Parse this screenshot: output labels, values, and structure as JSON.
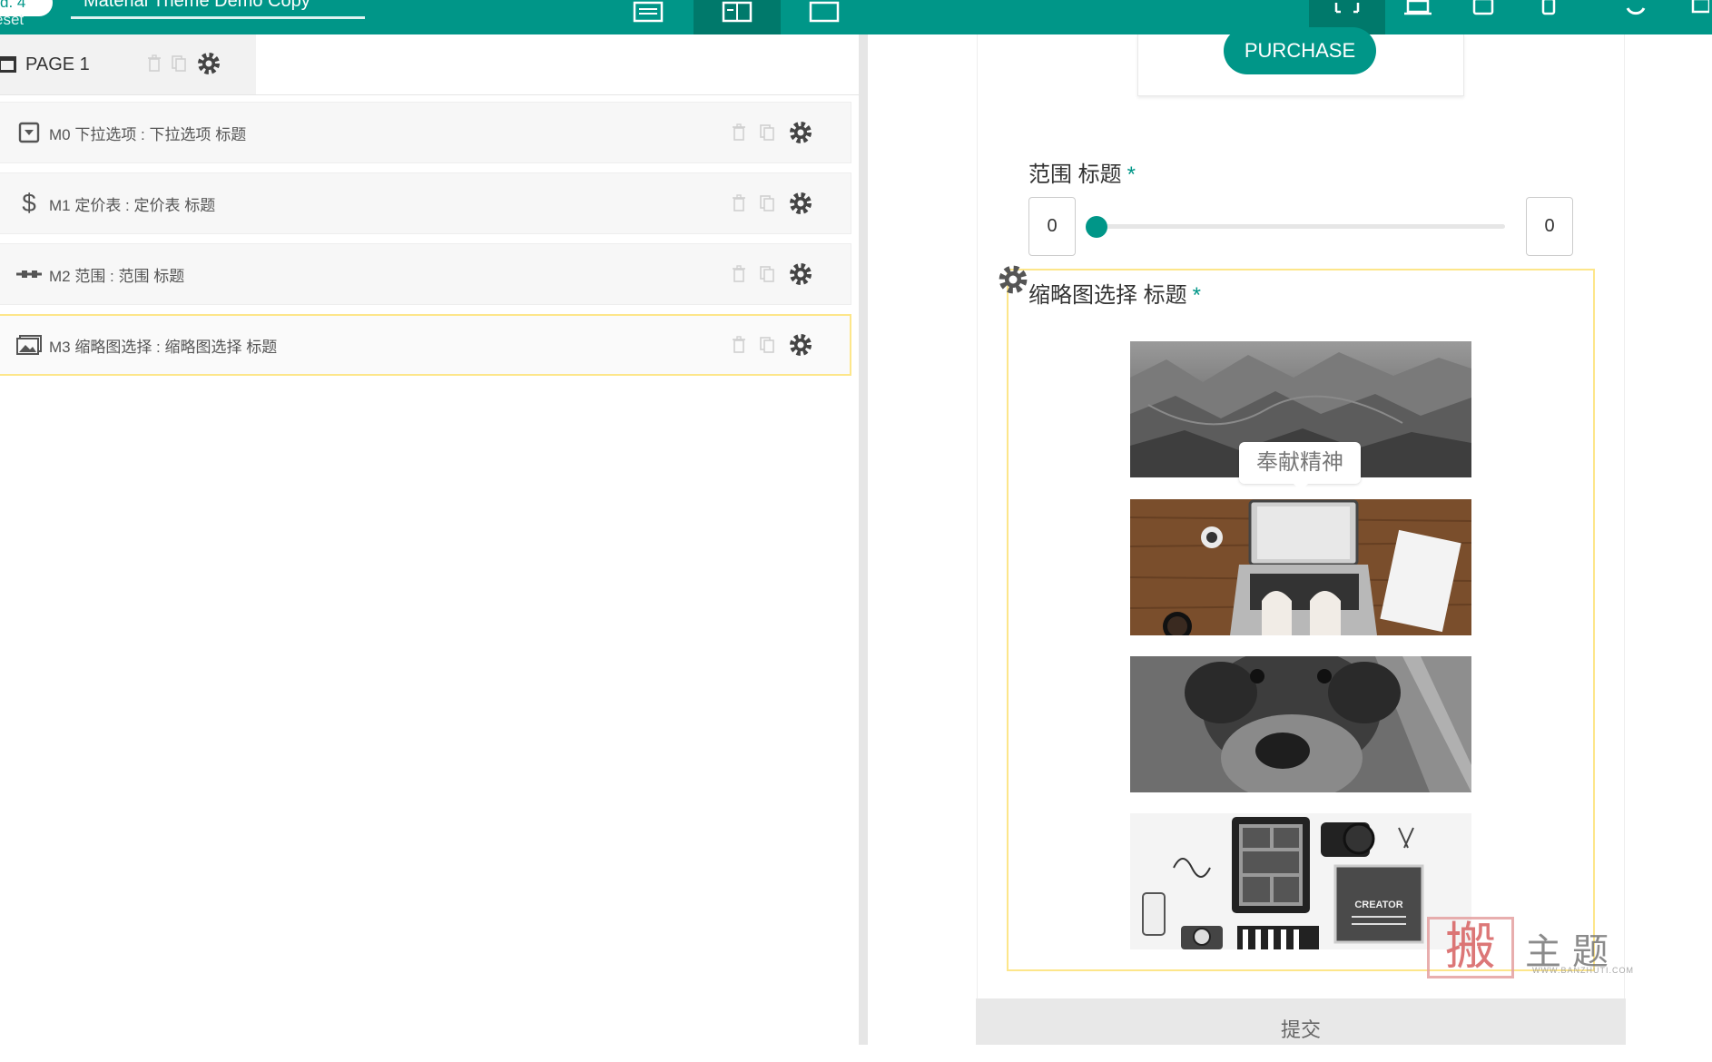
{
  "toolbar": {
    "pill_label": "d. 4",
    "reset_label": "eset",
    "form_title": "Material Theme Demo Copy",
    "buttons": [
      "list-view-icon",
      "split-view-icon",
      "preview-icon"
    ],
    "device_buttons": [
      "fullscreen-icon",
      "desktop-icon",
      "tablet-icon",
      "mobile-icon",
      "refresh-icon"
    ]
  },
  "left": {
    "page_label": "PAGE 1",
    "rows": [
      {
        "label": "M0 下拉选项 : 下拉选项 标题",
        "icon": "dropdown-icon"
      },
      {
        "label": "M1 定价表 : 定价表 标题",
        "icon": "dollar-icon"
      },
      {
        "label": "M2 范围 : 范围 标题",
        "icon": "range-icon"
      },
      {
        "label": "M3 缩略图选择 : 缩略图选择 标题",
        "icon": "image-icon"
      }
    ]
  },
  "preview": {
    "purchase_label": "PURCHASE",
    "range_title": "范围 标题",
    "required_mark": "*",
    "range_min": "0",
    "range_max": "0",
    "range_value": 0,
    "thumb_title": "缩略图选择 标题",
    "tooltip": "奉献精神",
    "thumbnails": [
      "mountains-thumbnail",
      "laptop-desk-thumbnail",
      "dog-thumbnail",
      "creator-flatlay-thumbnail"
    ],
    "thumb_text": "CREATOR",
    "submit_label": "提交"
  },
  "watermark": {
    "seal": "搬",
    "text": "主题",
    "url": "WWW.BANZHUTI.COM"
  },
  "colors": {
    "accent": "#009688",
    "accent_dark": "#00796b",
    "selection": "#fde68a"
  }
}
